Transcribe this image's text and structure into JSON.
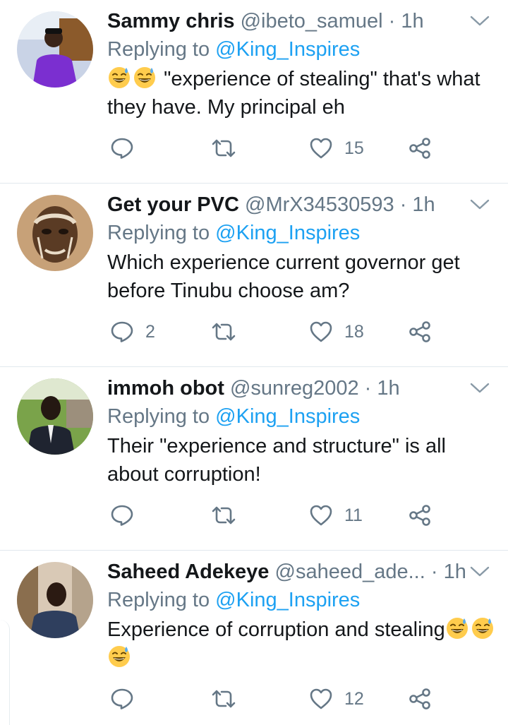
{
  "tweets": [
    {
      "name": "Sammy chris",
      "handle": "@ibeto_samuel",
      "dot": "·",
      "time": "1h",
      "replying_prefix": "Replying to",
      "replying_to": "@King_Inspires",
      "text_before_emoji": "",
      "leading_emoji_count": 2,
      "text": "\"experience of stealing\" that's what they have. My principal eh",
      "trailing_emoji_count": 0,
      "reply_count": "",
      "like_count": "15",
      "avatar": "man in purple outfit"
    },
    {
      "name": "Get your PVC",
      "handle": "@MrX34530593",
      "dot": "·",
      "time": "1h",
      "replying_prefix": "Replying to",
      "replying_to": "@King_Inspires",
      "leading_emoji_count": 0,
      "text": "Which experience current governor get before Tinubu choose am?",
      "trailing_emoji_count": 0,
      "reply_count": "2",
      "like_count": "18",
      "avatar": "sepia portrait"
    },
    {
      "name": "immoh obot",
      "handle": "@sunreg2002",
      "dot": "·",
      "time": "1h",
      "replying_prefix": "Replying to",
      "replying_to": "@King_Inspires",
      "leading_emoji_count": 0,
      "text": "Their \"experience and structure\" is all about corruption!",
      "trailing_emoji_count": 0,
      "reply_count": "",
      "like_count": "11",
      "avatar": "man in suit outdoors"
    },
    {
      "name": "Saheed Adekeye",
      "handle": "@saheed_ade...",
      "dot": "·",
      "time": "1h",
      "replying_prefix": "Replying to",
      "replying_to": "@King_Inspires",
      "leading_emoji_count": 0,
      "text": "Experience of corruption and stealing",
      "trailing_emoji_count": 3,
      "reply_count": "",
      "like_count": "12",
      "avatar": "man in shop"
    }
  ],
  "icons": {
    "reply": "reply-icon",
    "retweet": "retweet-icon",
    "like": "heart-icon",
    "share": "share-icon",
    "menu": "chevron-down-icon"
  },
  "colors": {
    "name": "#14171a",
    "secondary": "#657786",
    "mention": "#1da1f2",
    "divider": "#e1e8ed"
  }
}
